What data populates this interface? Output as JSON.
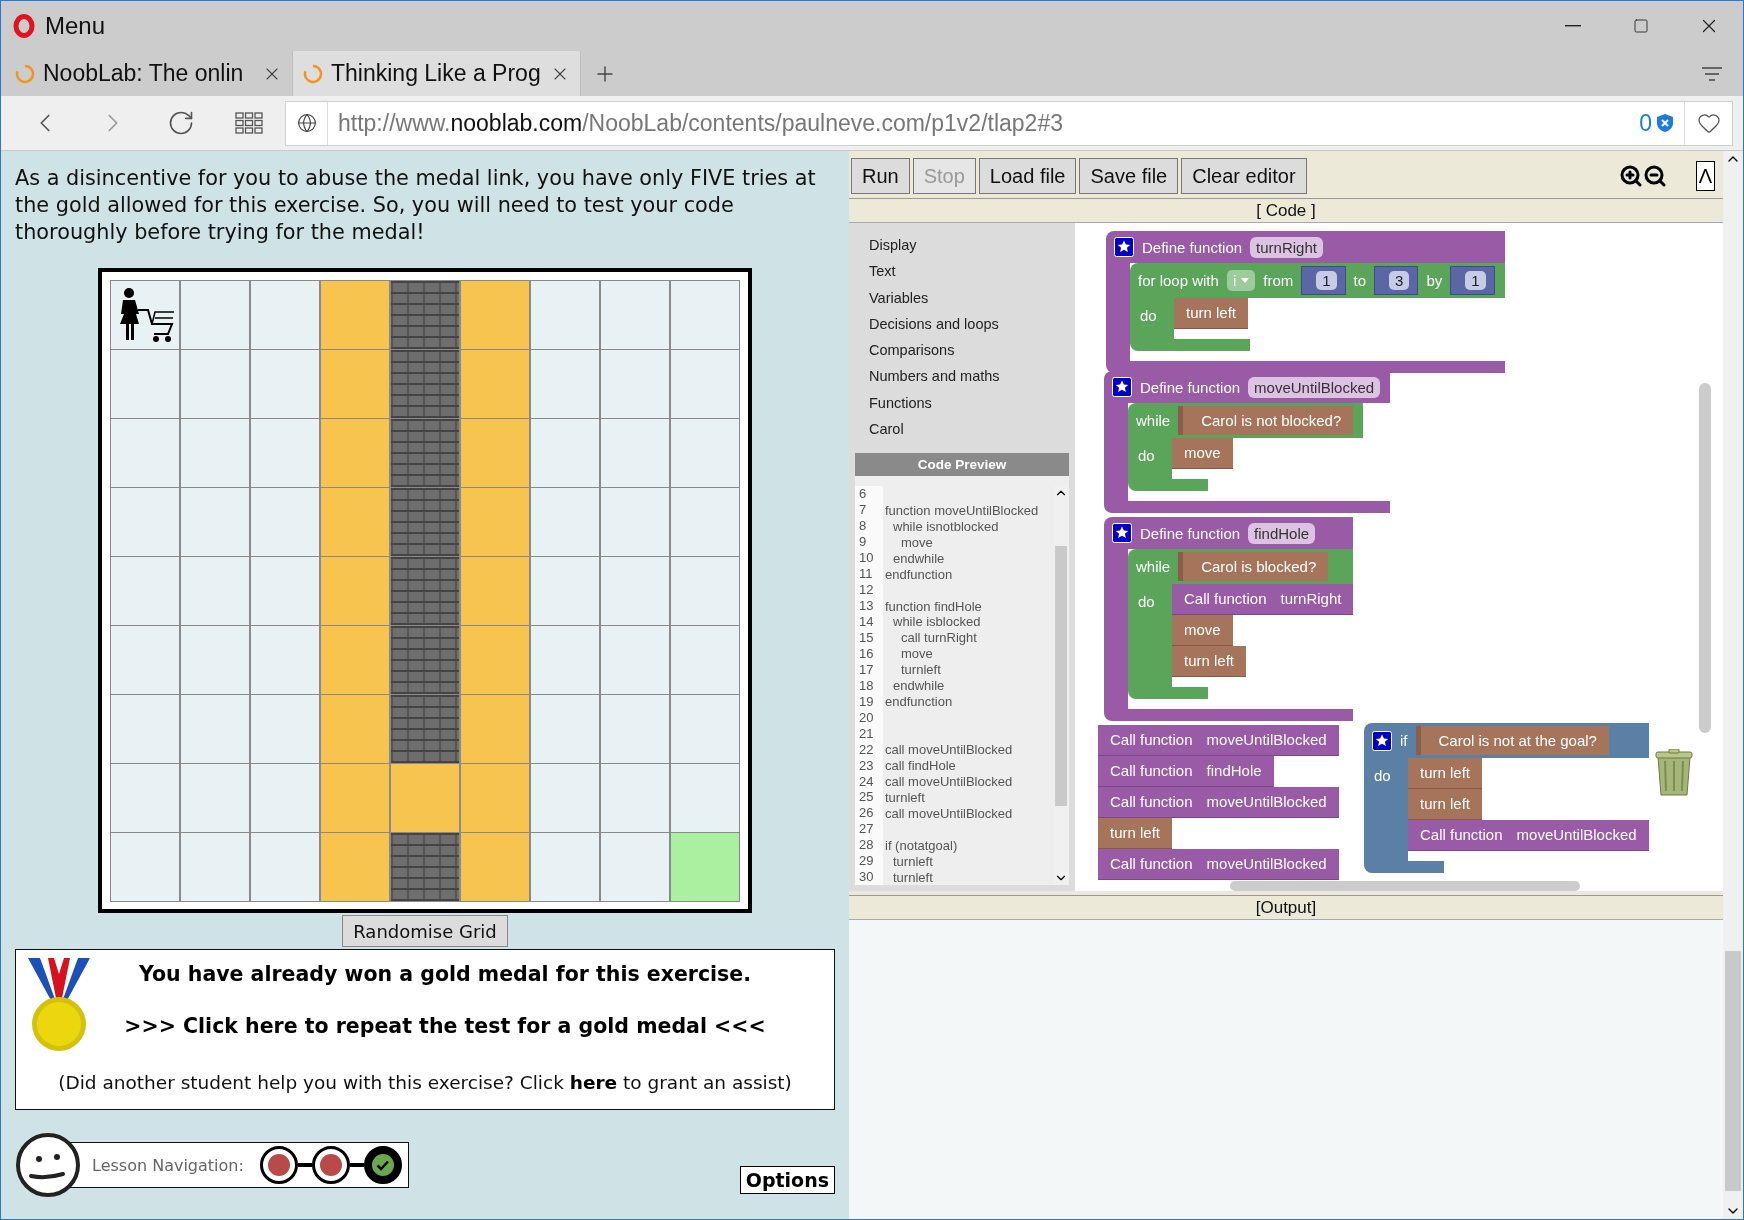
{
  "browser": {
    "menu_label": "Menu",
    "tabs": [
      {
        "title": "NoobLab: The onlin",
        "selected": false
      },
      {
        "title": "Thinking Like a Prog",
        "selected": true
      }
    ],
    "address": {
      "prefix": "http://www.",
      "domain": "nooblab.com",
      "path": "/NoobLab/contents/paulneve.com/p1v2/tlap2#3"
    },
    "badge_count": "0"
  },
  "instructions": "As a disincentive for you to abuse the medal link, you have only FIVE tries at the gold allowed for this exercise. So, you will need to test your code thoroughly before trying for the medal!",
  "grid": {
    "rows": [
      [
        {
          "kind": "start"
        },
        {
          "kind": "floor"
        },
        {
          "kind": "floor"
        },
        {
          "kind": "path"
        },
        {
          "kind": "wall"
        },
        {
          "kind": "path"
        },
        {
          "kind": "floor"
        },
        {
          "kind": "floor"
        },
        {
          "kind": "floor"
        }
      ],
      [
        {
          "kind": "floor"
        },
        {
          "kind": "floor"
        },
        {
          "kind": "floor"
        },
        {
          "kind": "path"
        },
        {
          "kind": "wall"
        },
        {
          "kind": "path"
        },
        {
          "kind": "floor"
        },
        {
          "kind": "floor"
        },
        {
          "kind": "floor"
        }
      ],
      [
        {
          "kind": "floor"
        },
        {
          "kind": "floor"
        },
        {
          "kind": "floor"
        },
        {
          "kind": "path"
        },
        {
          "kind": "wall"
        },
        {
          "kind": "path"
        },
        {
          "kind": "floor"
        },
        {
          "kind": "floor"
        },
        {
          "kind": "floor"
        }
      ],
      [
        {
          "kind": "floor"
        },
        {
          "kind": "floor"
        },
        {
          "kind": "floor"
        },
        {
          "kind": "path"
        },
        {
          "kind": "wall"
        },
        {
          "kind": "path"
        },
        {
          "kind": "floor"
        },
        {
          "kind": "floor"
        },
        {
          "kind": "floor"
        }
      ],
      [
        {
          "kind": "floor"
        },
        {
          "kind": "floor"
        },
        {
          "kind": "floor"
        },
        {
          "kind": "path"
        },
        {
          "kind": "wall"
        },
        {
          "kind": "path"
        },
        {
          "kind": "floor"
        },
        {
          "kind": "floor"
        },
        {
          "kind": "floor"
        }
      ],
      [
        {
          "kind": "floor"
        },
        {
          "kind": "floor"
        },
        {
          "kind": "floor"
        },
        {
          "kind": "path"
        },
        {
          "kind": "wall"
        },
        {
          "kind": "path"
        },
        {
          "kind": "floor"
        },
        {
          "kind": "floor"
        },
        {
          "kind": "floor"
        }
      ],
      [
        {
          "kind": "floor"
        },
        {
          "kind": "floor"
        },
        {
          "kind": "floor"
        },
        {
          "kind": "path"
        },
        {
          "kind": "wall"
        },
        {
          "kind": "path"
        },
        {
          "kind": "floor"
        },
        {
          "kind": "floor"
        },
        {
          "kind": "floor"
        }
      ],
      [
        {
          "kind": "floor"
        },
        {
          "kind": "floor"
        },
        {
          "kind": "floor"
        },
        {
          "kind": "path"
        },
        {
          "kind": "path"
        },
        {
          "kind": "path"
        },
        {
          "kind": "floor"
        },
        {
          "kind": "floor"
        },
        {
          "kind": "floor"
        }
      ],
      [
        {
          "kind": "floor"
        },
        {
          "kind": "floor"
        },
        {
          "kind": "floor"
        },
        {
          "kind": "path"
        },
        {
          "kind": "wall"
        },
        {
          "kind": "path"
        },
        {
          "kind": "floor"
        },
        {
          "kind": "floor"
        },
        {
          "kind": "goal"
        }
      ]
    ]
  },
  "randomise_button": "Randomise Grid",
  "medal": {
    "heading": "You have already won a gold medal for this exercise.",
    "repeat_link": ">>> Click here to repeat the test for a gold medal <<<",
    "assist_before": "(Did another student help you with this exercise? Click ",
    "assist_link": "here",
    "assist_after": " to grant an assist)"
  },
  "lesson_nav": {
    "label": "Lesson Navigation:",
    "steps": [
      {
        "done": false
      },
      {
        "done": false
      },
      {
        "done": true
      }
    ]
  },
  "options_button": "Options",
  "editor": {
    "buttons": [
      {
        "label": "Run",
        "disabled": false
      },
      {
        "label": "Stop",
        "disabled": true
      },
      {
        "label": "Load file",
        "disabled": false
      },
      {
        "label": "Save file",
        "disabled": false
      },
      {
        "label": "Clear editor",
        "disabled": false
      }
    ],
    "collapse_button": "Λ",
    "code_header": "[ Code ]",
    "categories": [
      "Display",
      "Text",
      "Variables",
      "Decisions and loops",
      "Comparisons",
      "Numbers and maths",
      "Functions",
      "Carol"
    ],
    "preview_title": "Code Preview",
    "preview_lines": [
      {
        "num": "6"
      },
      {
        "num": "7",
        "text": "function moveUntilBlocked",
        "children": [
          {
            "num": "8",
            "text": "while isnotblocked",
            "children": [
              {
                "num": "9",
                "text": "move"
              }
            ]
          },
          {
            "num": "10",
            "text": "endwhile"
          }
        ]
      },
      {
        "num": "11",
        "text": "endfunction"
      },
      {
        "num": "12"
      },
      {
        "num": "13",
        "text": "function findHole",
        "children": [
          {
            "num": "14",
            "text": "while isblocked",
            "children": [
              {
                "num": "15",
                "text": "call turnRight"
              },
              {
                "num": "16",
                "text": "move"
              },
              {
                "num": "17",
                "text": "turnleft"
              }
            ]
          },
          {
            "num": "18",
            "text": "endwhile"
          }
        ]
      },
      {
        "num": "19",
        "text": "endfunction"
      },
      {
        "num": "20"
      },
      {
        "num": "21"
      },
      {
        "num": "22",
        "text": "call moveUntilBlocked"
      },
      {
        "num": "23",
        "text": "call findHole"
      },
      {
        "num": "24",
        "text": "call moveUntilBlocked"
      },
      {
        "num": "25",
        "text": "turnleft"
      },
      {
        "num": "26",
        "text": "call moveUntilBlocked"
      },
      {
        "num": "27"
      },
      {
        "num": "28",
        "text": "if (notatgoal)",
        "children": [
          {
            "num": "29",
            "text": "turnleft"
          },
          {
            "num": "30",
            "text": "turnleft"
          }
        ]
      }
    ],
    "stacks": [
      [
        {
          "kind": "define",
          "label": "Define function",
          "name": "turnRight",
          "body": [
            {
              "kind": "for",
              "label": "for loop with",
              "variable": "i",
              "from_label": "from",
              "from": "1",
              "to_label": "to",
              "to": "3",
              "by_label": "by",
              "by": "1",
              "do_label": "do",
              "body": [
                {
                  "kind": "action",
                  "label": "turn left"
                }
              ]
            }
          ]
        }
      ],
      [
        {
          "kind": "define",
          "label": "Define function",
          "name": "moveUntilBlocked",
          "body": [
            {
              "kind": "while",
              "label": "while",
              "condition": "Carol is not blocked?",
              "do_label": "do",
              "body": [
                {
                  "kind": "action",
                  "label": "move"
                }
              ]
            }
          ]
        }
      ],
      [
        {
          "kind": "define",
          "label": "Define function",
          "name": "findHole",
          "body": [
            {
              "kind": "while",
              "label": "while",
              "condition": "Carol is blocked?",
              "do_label": "do",
              "body": [
                {
                  "kind": "call",
                  "label": "Call function",
                  "name": "turnRight"
                },
                {
                  "kind": "action",
                  "label": "move"
                },
                {
                  "kind": "action",
                  "label": "turn left"
                }
              ]
            }
          ]
        }
      ],
      [
        {
          "kind": "call",
          "label": "Call function",
          "name": "moveUntilBlocked"
        },
        {
          "kind": "call",
          "label": "Call function",
          "name": "findHole"
        },
        {
          "kind": "call",
          "label": "Call function",
          "name": "moveUntilBlocked"
        },
        {
          "kind": "action",
          "label": "turn left"
        },
        {
          "kind": "call",
          "label": "Call function",
          "name": "moveUntilBlocked"
        }
      ],
      [
        {
          "kind": "if",
          "label": "if",
          "condition": "Carol is not at the goal?",
          "do_label": "do",
          "body": [
            {
              "kind": "action",
              "label": "turn left"
            },
            {
              "kind": "action",
              "label": "turn left"
            },
            {
              "kind": "call",
              "label": "Call function",
              "name": "moveUntilBlocked"
            }
          ]
        }
      ]
    ],
    "output_header": "[Output]"
  }
}
